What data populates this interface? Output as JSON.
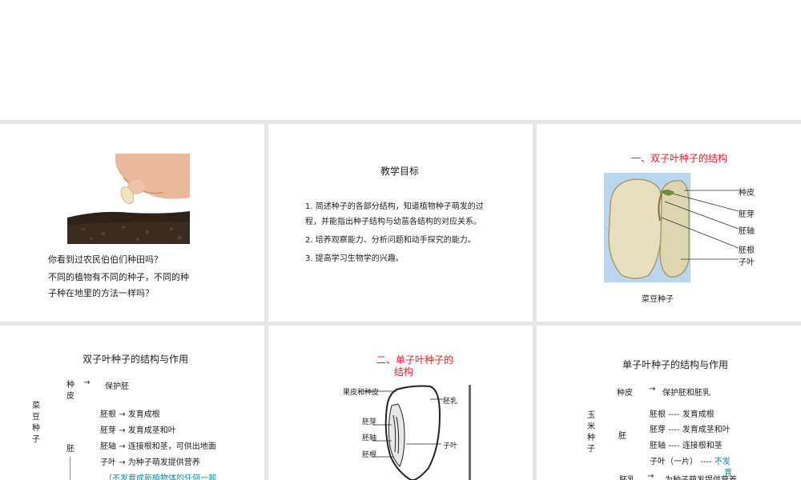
{
  "slide1": {
    "question1": "你看到过农民伯伯们种田吗？",
    "question2_line1": "不同的植物有不同的种子，不同的种",
    "question2_line2": "子种在地里的方法一样吗？"
  },
  "slide2": {
    "title": "教学目标",
    "item1_line1": "1.  简述种子的各部分结构，知道植物种子萌发的过",
    "item1_line2": "程，并能指出种子结构与幼苗各结构的对应关系。",
    "item2": "2.  培养观察能力、分析问题和动手探究的能力。",
    "item3": "3.  提高学习生物学的兴趣。"
  },
  "slide3": {
    "title": "一、双子叶种子的结构",
    "labels": [
      "种皮",
      "胚芽",
      "胚轴",
      "胚根",
      "子叶"
    ],
    "caption": "菜豆种子"
  },
  "slide4": {
    "title": "双子叶种子的结构与作用",
    "side_label": [
      "菜",
      "豆",
      "种",
      "子"
    ],
    "seed_coat": [
      "种",
      "皮"
    ],
    "seed_coat_arrow": "→",
    "seed_coat_func": "保护胚",
    "embryo": "胚",
    "rows": [
      {
        "part": "胚根",
        "arrow": "→",
        "func": "发育成根"
      },
      {
        "part": "胚芽",
        "arrow": "→",
        "func": "发育成茎和叶"
      },
      {
        "part": "胚轴",
        "arrow": "→",
        "func": "连接根和茎，可供出地面"
      },
      {
        "part": "子叶",
        "arrow": "→",
        "func": "为种子萌发提供营养"
      }
    ],
    "note": "（不发育成新植物体的任何一部"
  },
  "slide5": {
    "title_line1": "二、单子叶种子的",
    "title_line2": "结构",
    "labels": {
      "pericarp": "果皮和种皮",
      "endosperm": "胚乳",
      "plumule": "胚芽",
      "hypocotyl": "胚轴",
      "cotyledon": "子叶",
      "radicle": "胚根"
    }
  },
  "slide6": {
    "title": "单子叶种子的结构与作用",
    "side_label": [
      "玉",
      "米",
      "种",
      "子"
    ],
    "seed_coat": "种皮",
    "seed_coat_arrow": "→",
    "seed_coat_func": "保护胚和胚乳",
    "embryo": "胚",
    "rows": [
      {
        "part": "胚根",
        "dash": "----",
        "func": "发育成根"
      },
      {
        "part": "胚芽",
        "dash": "----",
        "func": "发育成茎和叶"
      },
      {
        "part": "胚轴",
        "dash": "----",
        "func": "连接根和茎"
      }
    ],
    "cotyledon_part": "子叶（一片）",
    "cotyledon_dash": "----",
    "cotyledon_func_line1": "不发",
    "cotyledon_func_line2": "育",
    "endosperm": "胚乳",
    "endosperm_arrow": "→",
    "endosperm_func": "为种子萌发提供营养"
  },
  "colors": {
    "accent_red": "#d9232e",
    "teal": "#1a8a9a",
    "gap": "#e6e6e6"
  }
}
